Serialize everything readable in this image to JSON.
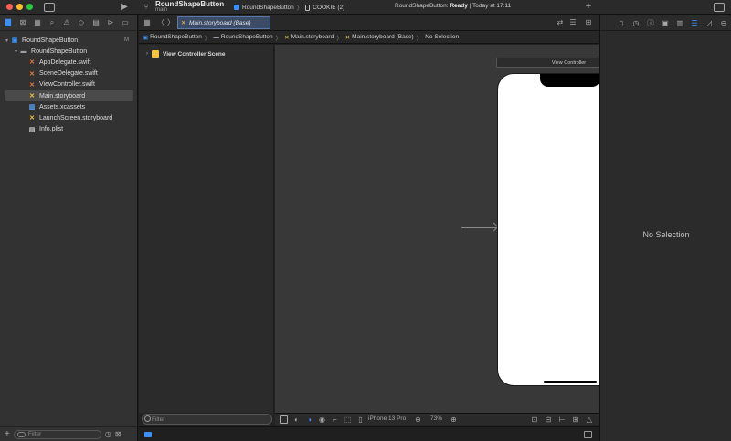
{
  "toolbar": {
    "project_name": "RoundShapeButton",
    "branch": "main",
    "scheme": "RoundShapeButton",
    "destination": "COOKIE (2)",
    "status_prefix": "RoundShapeButton: ",
    "status_state": "Ready",
    "status_suffix": " | Today at 17:11",
    "add_label": "+"
  },
  "traffic_lights": {
    "close": "#ff5f57",
    "minimize": "#febc2e",
    "zoom": "#28c840"
  },
  "navigator": {
    "tabs": [
      "folder-icon",
      "source-control-icon",
      "symbol-icon",
      "find-icon",
      "issue-icon",
      "test-icon",
      "debug-icon",
      "breakpoint-icon",
      "report-icon"
    ],
    "project": {
      "label": "RoundShapeButton",
      "badge": "M"
    },
    "group": "RoundShapeButton",
    "files": [
      {
        "label": "AppDelegate.swift",
        "kind": "swift"
      },
      {
        "label": "SceneDelegate.swift",
        "kind": "swift"
      },
      {
        "label": "ViewController.swift",
        "kind": "swift"
      },
      {
        "label": "Main.storyboard",
        "kind": "story"
      },
      {
        "label": "Assets.xcassets",
        "kind": "xcassets"
      },
      {
        "label": "LaunchScreen.storyboard",
        "kind": "story"
      },
      {
        "label": "Info.plist",
        "kind": "plist"
      }
    ],
    "filter_placeholder": "Filter"
  },
  "editor": {
    "tab_label": "Main.storyboard (Base)",
    "breadcrumb": [
      "RoundShapeButton",
      "RoundShapeButton",
      "Main.storyboard",
      "Main.storyboard (Base)",
      "No Selection"
    ],
    "outline_item": "View Controller Scene",
    "outline_filter": "Filter",
    "vc_title": "View Controller",
    "device": "iPhone 13 Pro",
    "zoom": "73%"
  },
  "inspector": {
    "empty_label": "No Selection"
  },
  "colors": {
    "accent": "#3d8ff5",
    "selection": "#4a4a4a"
  }
}
